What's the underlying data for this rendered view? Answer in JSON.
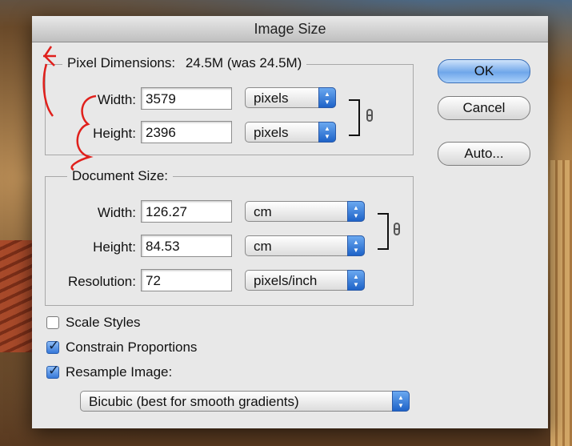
{
  "dialog": {
    "title": "Image Size",
    "buttons": {
      "ok": "OK",
      "cancel": "Cancel",
      "auto": "Auto..."
    }
  },
  "pixel_dimensions": {
    "title": "Pixel Dimensions:",
    "size": "24.5M (was 24.5M)",
    "width_label": "Width:",
    "width_value": "3579",
    "width_unit": "pixels",
    "height_label": "Height:",
    "height_value": "2396",
    "height_unit": "pixels"
  },
  "document_size": {
    "title": "Document Size:",
    "width_label": "Width:",
    "width_value": "126.27",
    "width_unit": "cm",
    "height_label": "Height:",
    "height_value": "84.53",
    "height_unit": "cm",
    "resolution_label": "Resolution:",
    "resolution_value": "72",
    "resolution_unit": "pixels/inch"
  },
  "options": {
    "scale_styles": {
      "label": "Scale Styles",
      "checked": false
    },
    "constrain_proportions": {
      "label": "Constrain Proportions",
      "checked": true
    },
    "resample_image": {
      "label": "Resample Image:",
      "checked": true
    },
    "resample_method": "Bicubic (best for smooth gradients)"
  },
  "annotation": {
    "color": "#e0201c"
  },
  "icons": {
    "stepper": "up-down-arrows-icon",
    "link": "chain-link-icon"
  }
}
